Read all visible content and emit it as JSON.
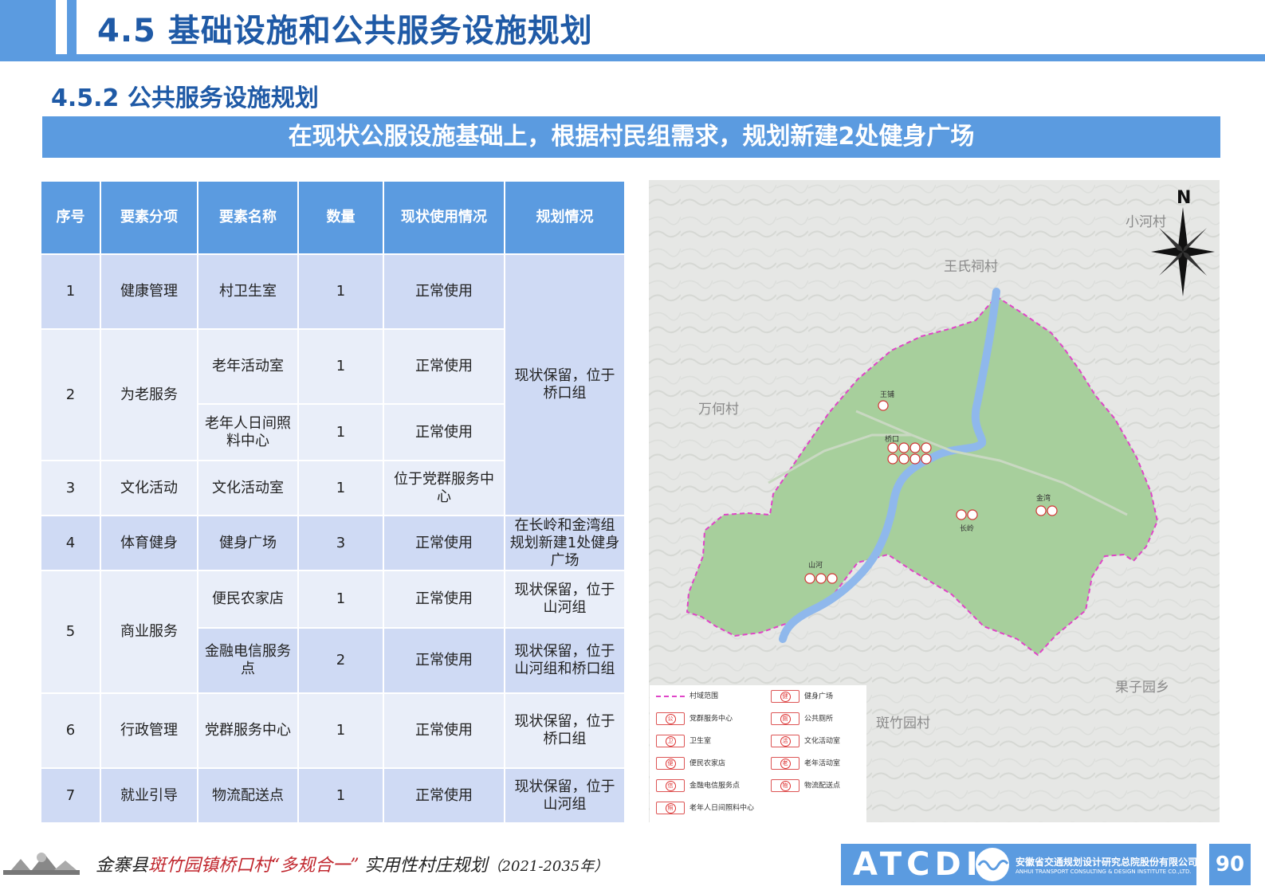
{
  "header": {
    "title": "4.5 基础设施和公共服务设施规划",
    "subtitle": "4.5.2 公共服务设施规划",
    "banner": "在现状公服设施基础上，根据村民组需求，规划新建2处健身广场"
  },
  "table": {
    "headers": [
      "序号",
      "要素分项",
      "要素名称",
      "数量",
      "现状使用情况",
      "规划情况"
    ],
    "groups": [
      {
        "no": "1",
        "category": "健康管理",
        "rows": [
          {
            "name": "村卫生室",
            "qty": "1",
            "status": "正常使用"
          }
        ]
      },
      {
        "no": "2",
        "category": "为老服务",
        "rows": [
          {
            "name": "老年活动室",
            "qty": "1",
            "status": "正常使用"
          },
          {
            "name": "老年人日间照料中心",
            "qty": "1",
            "status": "正常使用"
          }
        ]
      },
      {
        "no": "3",
        "category": "文化活动",
        "rows": [
          {
            "name": "文化活动室",
            "qty": "1",
            "status": "位于党群服务中心"
          }
        ]
      },
      {
        "no": "4",
        "category": "体育健身",
        "rows": [
          {
            "name": "健身广场",
            "qty": "3",
            "status": "正常使用",
            "plan": "在长岭和金湾组规划新建1处健身广场"
          }
        ]
      },
      {
        "no": "5",
        "category": "商业服务",
        "rows": [
          {
            "name": "便民农家店",
            "qty": "1",
            "status": "正常使用",
            "plan": "现状保留，位于山河组"
          },
          {
            "name": "金融电信服务点",
            "qty": "2",
            "status": "正常使用",
            "plan": "现状保留，位于山河组和桥口组"
          }
        ]
      },
      {
        "no": "6",
        "category": "行政管理",
        "rows": [
          {
            "name": "党群服务中心",
            "qty": "1",
            "status": "正常使用",
            "plan": "现状保留，位于桥口组"
          }
        ]
      },
      {
        "no": "7",
        "category": "就业引导",
        "rows": [
          {
            "name": "物流配送点",
            "qty": "1",
            "status": "正常使用",
            "plan": "现状保留，位于山河组"
          }
        ]
      }
    ],
    "merged_plan_1_3": "现状保留，位于桥口组"
  },
  "map": {
    "north": "N",
    "neighbors": [
      "小河村",
      "王氏祠村",
      "万何村",
      "果子园乡",
      "斑竹园村"
    ],
    "groups": [
      "王铺",
      "桥口",
      "金湾",
      "长岭",
      "山河"
    ],
    "legend": [
      {
        "label": "村域范围",
        "type": "dash"
      },
      {
        "label": "健身广场",
        "sym": "健"
      },
      {
        "label": "党群服务中心",
        "sym": "公"
      },
      {
        "label": "公共厕所",
        "sym": "厕"
      },
      {
        "label": "卫生室",
        "sym": "卫"
      },
      {
        "label": "文化活动室",
        "sym": "活"
      },
      {
        "label": "便民农家店",
        "sym": "便"
      },
      {
        "label": "老年活动室",
        "sym": "老"
      },
      {
        "label": "金融电信服务点",
        "sym": "信"
      },
      {
        "label": "物流配送点",
        "sym": "物"
      },
      {
        "label": "老年人日间照料中心",
        "sym": "照"
      }
    ],
    "colors": {
      "village": "#a7cf9c",
      "river": "#8fb8ec",
      "boundary": "#e045c8",
      "poi": "#d33333"
    }
  },
  "footer": {
    "county": "金寨县",
    "red_part": "斑竹园镇桥口村",
    "quote": "“多规合一”",
    "tail": "实用性村庄规划",
    "years": "（2021-2035年）",
    "logo": "ATCDI",
    "org_cn": "安徽省交通规划设计研究总院股份有限公司",
    "org_en": "ANHUI TRANSPORT CONSULTING & DESIGN INSTITUTE CO.,LTD.",
    "page": "90"
  }
}
